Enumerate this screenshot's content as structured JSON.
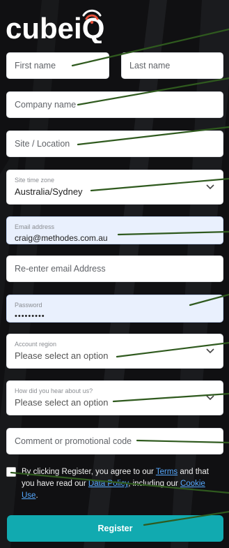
{
  "brand": {
    "logo_text": "cubeiQ"
  },
  "form": {
    "first_name_placeholder": "First name",
    "last_name_placeholder": "Last name",
    "company_placeholder": "Company name",
    "site_placeholder": "Site / Location",
    "timezone_label": "Site time zone",
    "timezone_value": "Australia/Sydney",
    "email_label": "Email address",
    "email_value": "craig@methodes.com.au",
    "reenter_email_placeholder": "Re-enter email Address",
    "password_label": "Password",
    "password_value": "•••••••••",
    "region_label": "Account region",
    "region_value": "Please select an option",
    "hear_label": "How did you hear about us?",
    "hear_value": "Please select an option",
    "comment_placeholder": "Comment or promotional code"
  },
  "consent": {
    "text_1": "By clicking Register, you agree to our ",
    "terms_link": "Terms",
    "text_2": " and that you have read our ",
    "policy_link": "Data Policy",
    "text_3": ", including our ",
    "cookie_link": "Cookie Use",
    "text_4": "."
  },
  "register_label": "Register",
  "colors": {
    "accent": "#11aab0",
    "logo_orange": "#e8503a",
    "annotation": "#2f5a1e",
    "link": "#56a9ff"
  },
  "icons": {
    "select_arrow": "chevron-down-icon",
    "logo_mark": "wifi-signal-icon"
  }
}
